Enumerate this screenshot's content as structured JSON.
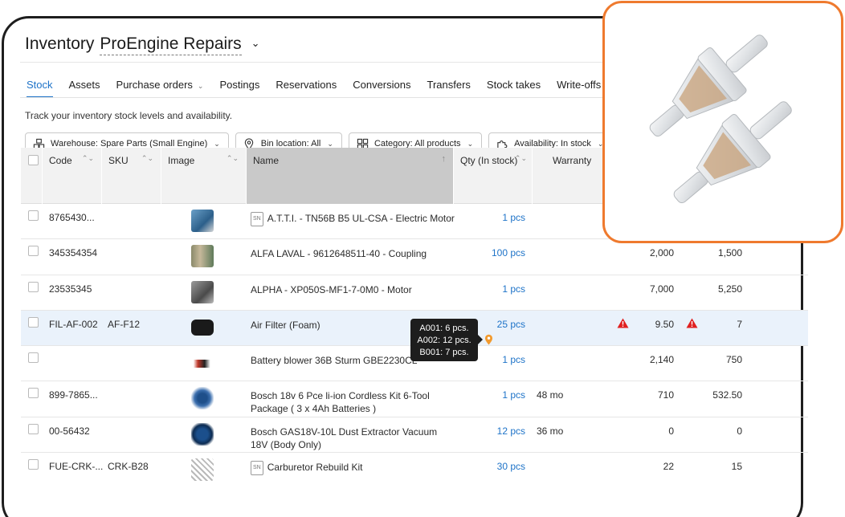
{
  "header": {
    "title_prefix": "Inventory",
    "store_name": "ProEngine Repairs",
    "store_chevron": "⌄"
  },
  "tabs": [
    {
      "label": "Stock",
      "active": true
    },
    {
      "label": "Assets"
    },
    {
      "label": "Purchase orders",
      "has_dropdown": true
    },
    {
      "label": "Postings"
    },
    {
      "label": "Reservations"
    },
    {
      "label": "Conversions"
    },
    {
      "label": "Transfers"
    },
    {
      "label": "Stock takes"
    },
    {
      "label": "Write-offs"
    }
  ],
  "description": "Track your inventory stock levels and availability.",
  "filters": {
    "warehouse": "Warehouse: Spare Parts (Small Engine)",
    "bin": "Bin location: All",
    "category": "Category: All products",
    "availability": "Availability: In stock"
  },
  "columns": {
    "code": "Code",
    "sku": "SKU",
    "image": "Image",
    "name": "Name",
    "qty": "Qty (In stock)",
    "warranty": "Warranty"
  },
  "rows": [
    {
      "code": "8765430...",
      "sku": "",
      "name": "A.T.T.I. - TN56B B5 UL-CSA - Electric Motor",
      "serial": true,
      "qty": "1 pcs",
      "warranty": "",
      "col1": "",
      "col2": ""
    },
    {
      "code": "345354354",
      "sku": "",
      "name": "ALFA LAVAL - 9612648511-40 - Coupling",
      "serial": false,
      "qty": "100 pcs",
      "warranty": "",
      "col1": "2,000",
      "col2": "1,500"
    },
    {
      "code": "23535345",
      "sku": "",
      "name": "ALPHA - XP050S-MF1-7-0M0 - Motor",
      "serial": false,
      "qty": "1 pcs",
      "warranty": "",
      "col1": "7,000",
      "col2": "5,250"
    },
    {
      "code": "FIL-AF-002",
      "sku": "AF-F12",
      "name": "Air Filter (Foam)",
      "serial": false,
      "qty": "25 pcs",
      "warranty": "",
      "col1": "9.50",
      "col2": "7",
      "highlighted": true
    },
    {
      "code": "",
      "sku": "",
      "name": "Battery blower 36B Sturm GBE2230CL",
      "serial": false,
      "qty": "1 pcs",
      "warranty": "",
      "col1": "2,140",
      "col2": "750"
    },
    {
      "code": "899-7865...",
      "sku": "",
      "name": "Bosch 18v 6 Pce li-ion Cordless Kit 6-Tool",
      "name2": "Package ( 3 x 4Ah Batteries )",
      "serial": false,
      "qty": "1 pcs",
      "warranty": "48 mo",
      "col1": "710",
      "col2": "532.50"
    },
    {
      "code": "00-56432",
      "sku": "",
      "name": "Bosch GAS18V-10L Dust Extractor Vacuum",
      "name2": "18V (Body Only)",
      "serial": false,
      "qty": "12 pcs",
      "warranty": "36 mo",
      "col1": "0",
      "col2": "0"
    },
    {
      "code": "FUE-CRK-...",
      "sku": "CRK-B28",
      "name": "Carburetor Rebuild Kit",
      "serial": true,
      "qty": "30 pcs",
      "warranty": "",
      "col1": "22",
      "col2": "15"
    }
  ],
  "serial_badge": "SN",
  "tooltip": {
    "lines": [
      "A001: 6 pcs.",
      "A002: 12 pcs.",
      "B001: 7 pcs."
    ]
  },
  "icons": [
    "warehouse-icon",
    "pin-icon",
    "grid-icon",
    "puzzle-icon",
    "warning-icon",
    "location-pin-icon"
  ],
  "colors": {
    "accent": "#1e73c8",
    "preview_border": "#ef7a2e",
    "warning": "#e02020",
    "pin": "#f29a2e",
    "highlight_row": "#eaf2fb"
  }
}
